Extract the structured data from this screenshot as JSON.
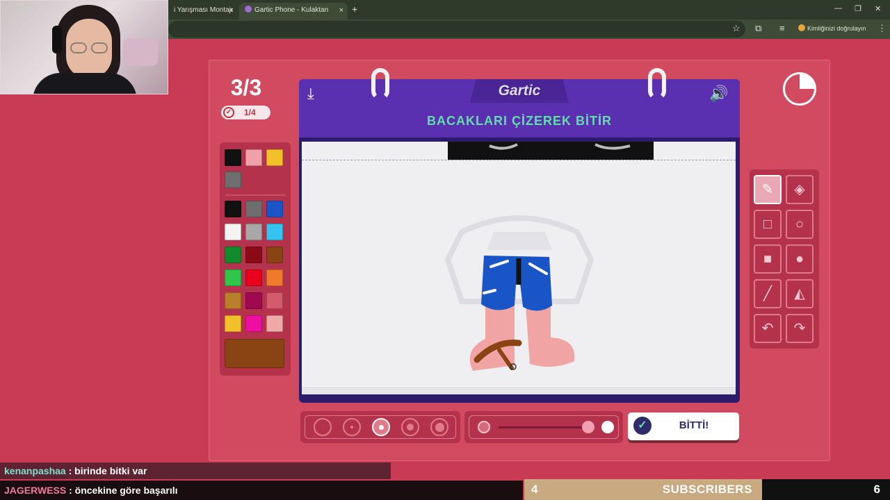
{
  "browser": {
    "tabs": [
      {
        "label": "i Yarışması Montajı #"
      },
      {
        "label": "Gartic Phone - Kulaktan Kulağa"
      }
    ],
    "close_glyph": "×",
    "new_tab_glyph": "+",
    "profile_label": "Kimliğinizi doğrulayın",
    "icons": [
      "star-icon",
      "extensions-icon",
      "media-icon",
      "menu-icon"
    ]
  },
  "game": {
    "round": "3/3",
    "sub_progress": "1/4",
    "check_glyph": "✓",
    "logo": "Gartic",
    "instruction": "BACAKLARI ÇİZEREK BİTİR",
    "download_glyph": "⤓",
    "sound_glyph": "🔊",
    "done_label": "BİTTİ!",
    "done_glyph": "✓",
    "selected_size_index": 2,
    "opacity_level": 1.0
  },
  "palette": {
    "recent": [
      "#111111",
      "#f0a0a8",
      "#f2c028",
      "#6e6e6e"
    ],
    "colors": [
      "#111111",
      "#6e6e6e",
      "#1a55c8",
      "#f4f4f4",
      "#a8a8a8",
      "#33c4f0",
      "#138a2b",
      "#8a0a18",
      "#8a4413",
      "#2fc64a",
      "#e8001c",
      "#f07a2a",
      "#b8802a",
      "#a00850",
      "#d45a6e",
      "#f2c028",
      "#ee10a0",
      "#f0a8a8"
    ],
    "current": "#8a4413"
  },
  "tools": [
    {
      "name": "pencil",
      "glyph": "✎",
      "active": true
    },
    {
      "name": "eraser",
      "glyph": "◈",
      "active": false
    },
    {
      "name": "rectangle-outline",
      "glyph": "□",
      "active": false
    },
    {
      "name": "ellipse-outline",
      "glyph": "○",
      "active": false
    },
    {
      "name": "rectangle-filled",
      "glyph": "■",
      "active": false
    },
    {
      "name": "ellipse-filled",
      "glyph": "●",
      "active": false
    },
    {
      "name": "line",
      "glyph": "╱",
      "active": false
    },
    {
      "name": "fill-bucket",
      "glyph": "◭",
      "active": false
    },
    {
      "name": "undo",
      "glyph": "↶",
      "active": false
    },
    {
      "name": "redo",
      "glyph": "↷",
      "active": false
    }
  ],
  "stream": {
    "chat": [
      {
        "user": "kenanpashaa",
        "message": ": birinde bitki var"
      },
      {
        "user": "JAGERWESS",
        "message": ": öncekine göre başarılı"
      }
    ],
    "subs_count": "4",
    "subs_label": "SUBSCRIBERS",
    "subs_goal": "6"
  }
}
